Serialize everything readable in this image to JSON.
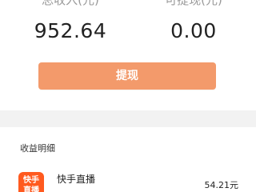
{
  "summary": {
    "total_income_label": "总收入(元)",
    "total_income_value": "952.64",
    "withdrawable_label": "可提现(元)",
    "withdrawable_value": "0.00",
    "withdraw_button": "提现"
  },
  "colors": {
    "button": "#f39a6b",
    "logo": "#ff5a1f",
    "divider": "#f2f2f2"
  },
  "details": {
    "title": "收益明细",
    "items": [
      {
        "logo_line1": "快手",
        "logo_line2": "直播",
        "name": "快手直播",
        "amount": "54.21元"
      }
    ]
  }
}
